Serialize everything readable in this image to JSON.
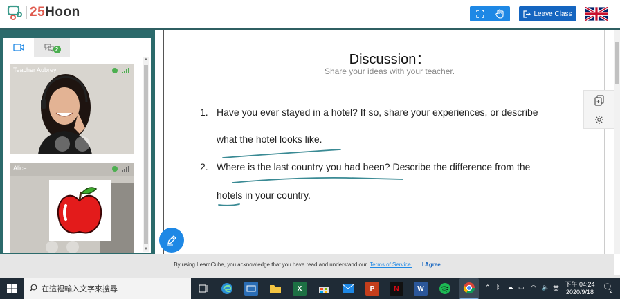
{
  "header": {
    "logo_number": "25",
    "logo_word": "Hoon",
    "leave_label": "Leave Class",
    "fullscreen_icon": "expand-icon",
    "raise_hand_icon": "hand-icon"
  },
  "sidebar": {
    "tabs": [
      {
        "icon": "video-icon"
      },
      {
        "icon": "chat-icon",
        "badge": "2"
      }
    ],
    "participants": [
      {
        "name": "Teacher Aubrey"
      },
      {
        "name": "Alice"
      }
    ]
  },
  "main": {
    "title": "Discussion：",
    "subtitle": "Share your ideas with your teacher.",
    "questions": [
      {
        "num": "1.",
        "line1": "Have you ever stayed in a hotel? If so, share your experiences, or describe",
        "line2": "what the hotel looks like."
      },
      {
        "num": "2.",
        "line1": "Where is the last country you had been? Describe the difference from the",
        "line2": "hotels in your country."
      }
    ]
  },
  "cookie": {
    "text": "By using LearnCube, you acknowledge that you have read and understand our",
    "link": "Terms of Service.",
    "agree": "I Agree"
  },
  "taskbar": {
    "search_placeholder": "在這裡輸入文字來搜尋",
    "time_prefix": "下午",
    "time": "04:24",
    "date": "2020/9/18",
    "notif_count": "2"
  },
  "colors": {
    "accent": "#1e88e5",
    "teal": "#2b6a6b",
    "leave": "#1565c0",
    "ink": "#3a8a94"
  }
}
